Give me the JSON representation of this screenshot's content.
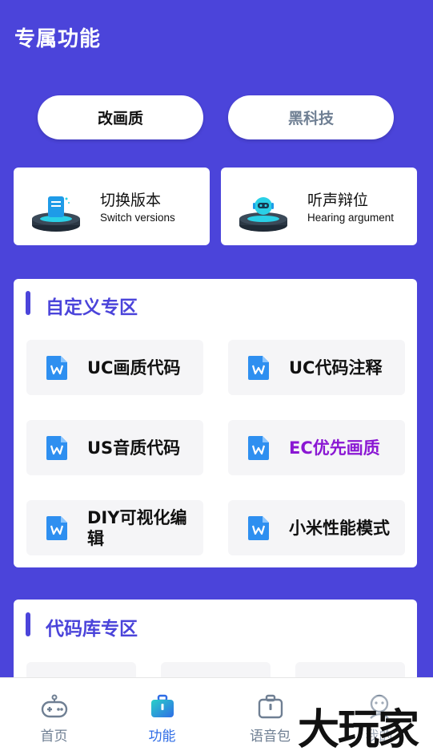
{
  "header": {
    "title": "专属功能"
  },
  "mode_tabs": [
    {
      "label": "改画质",
      "active": true
    },
    {
      "label": "黑科技",
      "active": false
    }
  ],
  "features": [
    {
      "title": "切换版本",
      "subtitle": "Switch versions",
      "icon": "phone-pedestal-icon"
    },
    {
      "title": "听声辩位",
      "subtitle": "Hearing argument",
      "icon": "robot-pedestal-icon"
    }
  ],
  "custom_zone": {
    "title": "自定义专区",
    "items": [
      {
        "label": "UC画质代码",
        "icon": "document-icon"
      },
      {
        "label": "UC代码注释",
        "icon": "document-icon"
      },
      {
        "label": "US音质代码",
        "icon": "document-icon"
      },
      {
        "label": "EC优先画质",
        "icon": "document-icon",
        "highlight_color": "#8A17D3"
      },
      {
        "label": "DIY可视化编辑",
        "icon": "document-icon"
      },
      {
        "label": "小米性能模式",
        "icon": "document-icon"
      }
    ]
  },
  "library_zone": {
    "title": "代码库专区"
  },
  "bottom_nav": [
    {
      "label": "首页",
      "icon": "gamepad-icon",
      "active": false
    },
    {
      "label": "功能",
      "icon": "briefcase-icon",
      "active": true
    },
    {
      "label": "语音包",
      "icon": "voice-pack-icon",
      "active": false
    },
    {
      "label": "我的",
      "icon": "profile-icon",
      "active": false
    }
  ],
  "watermark": {
    "text": "大玩家"
  },
  "colors": {
    "brand": "#4B44DA",
    "accent_purple": "#8A17D3",
    "nav_active": "#2f6de6",
    "nav_inactive": "#6f7f93"
  }
}
